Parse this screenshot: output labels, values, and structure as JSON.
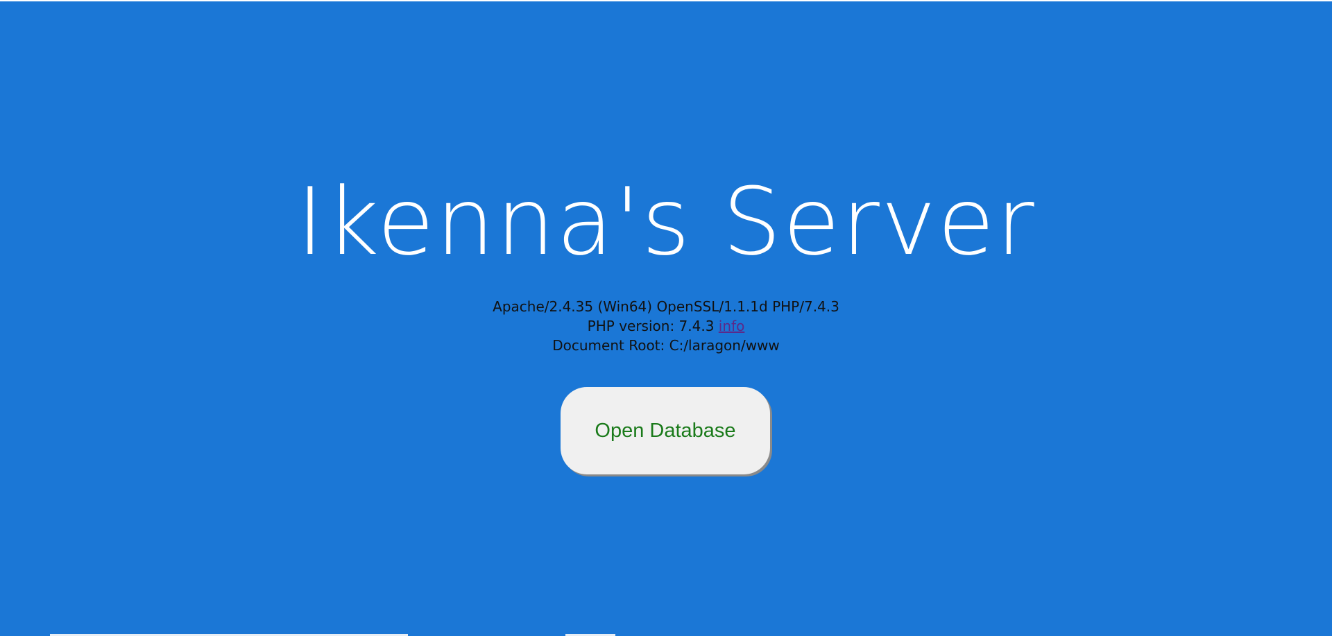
{
  "page": {
    "title": "Ikenna's Server"
  },
  "server_info": {
    "software": "Apache/2.4.35 (Win64) OpenSSL/1.1.1d PHP/7.4.3",
    "php_version_label": "PHP version: 7.4.3",
    "php_info_link": "info",
    "document_root": "Document Root: C:/laragon/www"
  },
  "actions": {
    "open_database_label": "Open Database"
  },
  "colors": {
    "background": "#1b77d6",
    "title_text": "#ffffff",
    "button_bg": "#f0f0f0",
    "button_text": "#1a7a1a",
    "link": "#5b2a8a"
  }
}
